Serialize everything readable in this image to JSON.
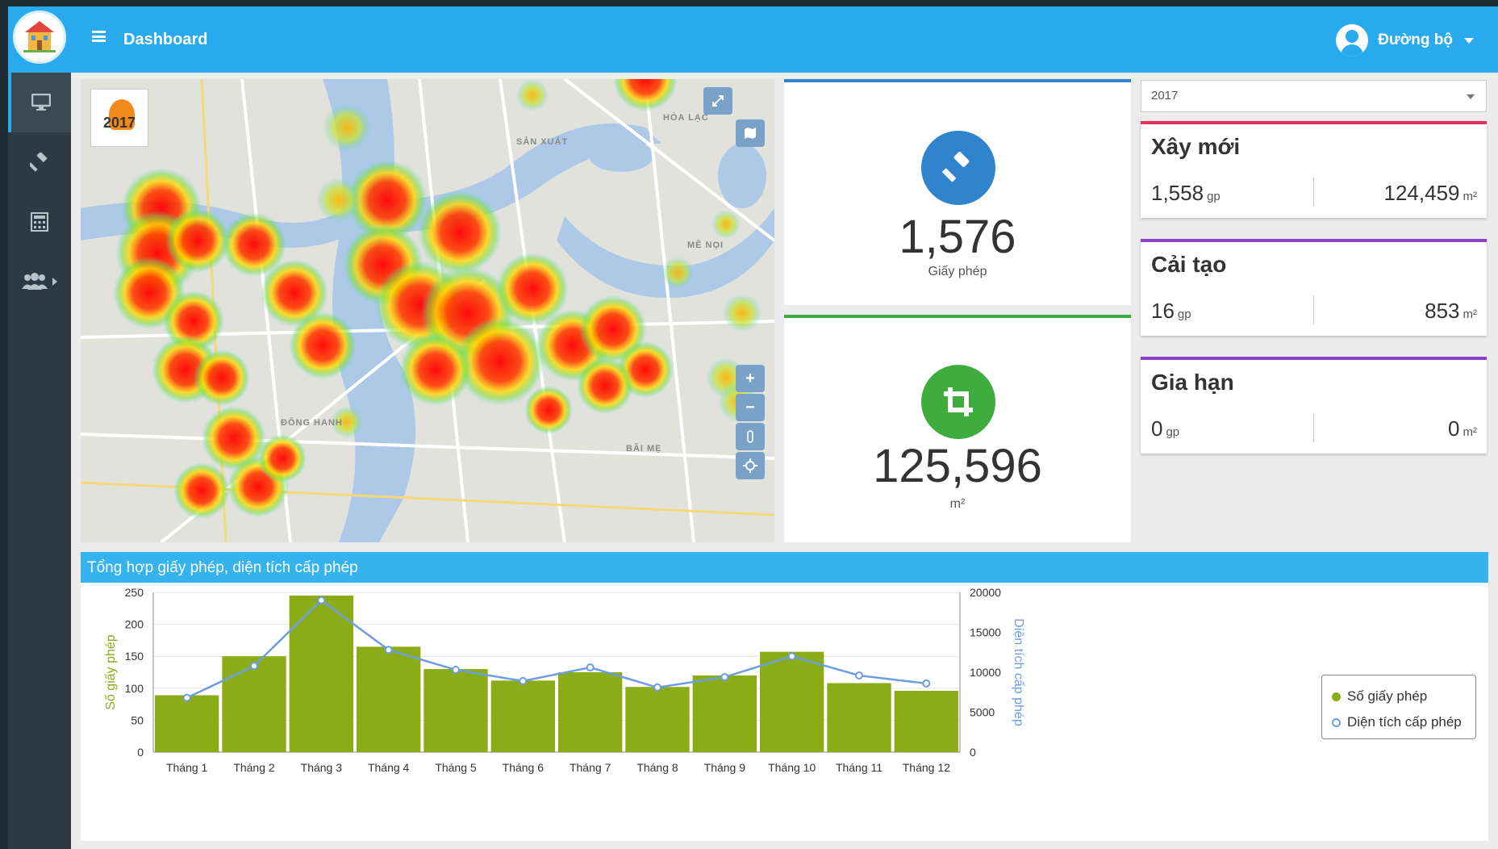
{
  "header": {
    "title": "Dashboard",
    "user_name": "Đường bộ"
  },
  "map": {
    "year_badge": "2017",
    "places": [
      "HÒA LẠC",
      "MÊ NỌI",
      "BÃI MẸ",
      "ĐÔNG HANH",
      "SẢN XUẤT"
    ]
  },
  "stats": {
    "permits": {
      "value": "1,576",
      "unit": "Giấy phép",
      "color": "#2f84cd"
    },
    "area": {
      "value": "125,596",
      "unit": "m²",
      "color": "#3fad3d"
    }
  },
  "year_select": {
    "value": "2017"
  },
  "types": [
    {
      "title": "Xây mới",
      "count": "1,558",
      "count_unit": "gp",
      "area": "124,459",
      "area_unit": "m²",
      "color": "#e8315a"
    },
    {
      "title": "Cải tạo",
      "count": "16",
      "count_unit": "gp",
      "area": "853",
      "area_unit": "m²",
      "color": "#8a42c8"
    },
    {
      "title": "Gia hạn",
      "count": "0",
      "count_unit": "gp",
      "area": "0",
      "area_unit": "m²",
      "color": "#8a42c8"
    }
  ],
  "chart_panel": {
    "title": "Tổng hợp giấy phép, diện tích cấp phép"
  },
  "chart_data": {
    "type": "bar",
    "categories": [
      "Tháng 1",
      "Tháng 2",
      "Tháng 3",
      "Tháng 4",
      "Tháng 5",
      "Tháng 6",
      "Tháng 7",
      "Tháng 8",
      "Tháng 9",
      "Tháng 10",
      "Tháng 11",
      "Tháng 12"
    ],
    "series": [
      {
        "name": "Số giấy phép",
        "type": "bar",
        "axis": "left",
        "color": "#8aac16",
        "values": [
          89,
          150,
          245,
          165,
          130,
          112,
          125,
          102,
          120,
          157,
          108,
          96
        ]
      },
      {
        "name": "Diện tích cấp phép",
        "type": "line",
        "axis": "right",
        "color": "#6d9de0",
        "values": [
          6800,
          10800,
          19000,
          12800,
          10300,
          8900,
          10600,
          8100,
          9400,
          12000,
          9600,
          8600
        ]
      }
    ],
    "ylabel": "Số giấy phép",
    "y2label": "Diện tích cấp phép",
    "ylim": [
      0,
      250
    ],
    "y2lim": [
      0,
      20000
    ],
    "yticks": [
      0,
      50,
      100,
      150,
      200,
      250
    ],
    "y2ticks": [
      0,
      5000,
      10000,
      15000,
      20000
    ],
    "grid": true,
    "legend_position": "right"
  }
}
